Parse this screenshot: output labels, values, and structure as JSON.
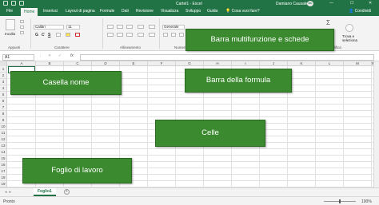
{
  "titlebar": {
    "title": "Cartel1 - Excel",
    "user": "Damiano Causale",
    "avatar_initials": "DC",
    "min": "—",
    "max": "☐",
    "close": "✕"
  },
  "tabs": [
    {
      "label": "File"
    },
    {
      "label": "Home"
    },
    {
      "label": "Inserisci"
    },
    {
      "label": "Layout di pagina"
    },
    {
      "label": "Formule"
    },
    {
      "label": "Dati"
    },
    {
      "label": "Revisione"
    },
    {
      "label": "Visualizza"
    },
    {
      "label": "Sviluppo"
    },
    {
      "label": "Guida"
    }
  ],
  "tell_me": "Cosa vuoi fare?",
  "share": "Condividi",
  "ribbon": {
    "paste": "Incolla",
    "font_name": "Calibri",
    "font_size": "11",
    "bold": "G",
    "italic": "C",
    "underline": "S",
    "number_format": "Generale",
    "find_select": "Trova e seleziona",
    "groups": [
      "Appunti",
      "Carattere",
      "Allineamento",
      "Numeri",
      "Modifica"
    ]
  },
  "formula_bar": {
    "name_box": "A1",
    "dots": "⋮",
    "fx": "fx",
    "value": ""
  },
  "grid": {
    "columns": [
      "A",
      "B",
      "C",
      "D",
      "E",
      "F",
      "G",
      "H",
      "I",
      "J",
      "K",
      "L",
      "M",
      "N"
    ],
    "rows": [
      "1",
      "2",
      "3",
      "4",
      "5",
      "6",
      "7",
      "8",
      "9",
      "10",
      "11",
      "12",
      "13",
      "14",
      "15",
      "16",
      "17",
      "18",
      "19"
    ]
  },
  "sheet_tab": "Foglio1",
  "add_sheet": "+",
  "status": {
    "ready": "Pronto",
    "zoom": "100%"
  },
  "callouts": {
    "ribbon": "Barra multifunzione e schede",
    "name_box": "Casella nome",
    "formula_bar": "Barra della formula",
    "cells": "Celle",
    "worksheet": "Foglio di lavoro"
  },
  "colors": {
    "excel_green": "#217346",
    "callout_green": "#3b8a2f"
  }
}
